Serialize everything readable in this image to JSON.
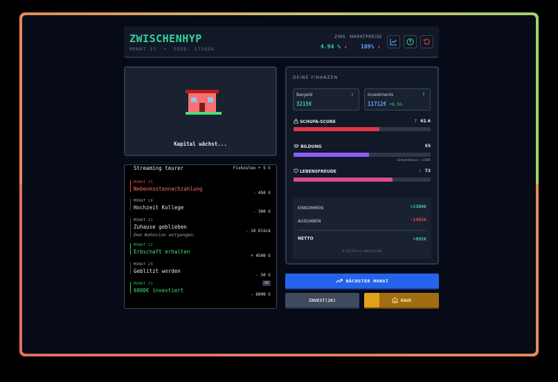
{
  "header": {
    "title": "ZWISCHENHYP",
    "month_label": "MONAT 23",
    "separator": "•",
    "seed_label": "SEED: 175688",
    "zins_label": "ZINS",
    "zins_value": "4.94 %",
    "zins_trend": "↓",
    "markt_label": "MARKTPREISE",
    "markt_value": "109%",
    "markt_trend": "↓",
    "buttons": [
      "chart-icon",
      "help-icon",
      "reset-icon"
    ]
  },
  "house": {
    "caption": "Kapital wächst..."
  },
  "log": [
    {
      "month": "",
      "title": "Streaming teurer",
      "amount": "Fixkosten + 5 €",
      "note": "",
      "tone": "gray"
    },
    {
      "month": "MONAT 15",
      "title": "Nebenkostennachzahlung",
      "amount": "- 450 €",
      "note": "",
      "tone": "red"
    },
    {
      "month": "MONAT 18",
      "title": "Hochzeit Kollege",
      "amount": "- 300 €",
      "note": "",
      "tone": "gray"
    },
    {
      "month": "MONAT 21",
      "title": "Zuhause geblieben",
      "amount": "- 10 Glück",
      "note": "Dem Wahnsinn entgangen.",
      "tone": "gray"
    },
    {
      "month": "MONAT 22",
      "title": "Erbschaft erhalten",
      "amount": "+ 4500 €",
      "note": "",
      "tone": "green"
    },
    {
      "month": "MONAT 23",
      "title": "Geblitzt worden",
      "amount": "- 50 €",
      "note": "",
      "tone": "gray"
    },
    {
      "month": "MONAT 23",
      "title": "6000€ investiert",
      "amount": "- 6000 €",
      "note": "",
      "tone": "green",
      "badge": "X6"
    }
  ],
  "finances": {
    "title": "DEINE FINANZEN",
    "cash": {
      "label": "Bargeld",
      "value": "3215€",
      "trend": "↓"
    },
    "investments": {
      "label": "Investments",
      "value": "11712€",
      "change": "+6.5%",
      "trend": "↑"
    },
    "schufa": {
      "label": "SCHUFA-SCORE",
      "value": "62.6",
      "trend": "↑",
      "level": 0.626,
      "color": "#dc3545"
    },
    "bildung": {
      "label": "BILDUNG",
      "value": "55",
      "level": 0.55,
      "color": "#8b5cf6",
      "bonus": "Gehalt-Bonus: +330€"
    },
    "lebensfreude": {
      "label": "LEBENSFREUDE",
      "value": "72",
      "trend": "↓",
      "level": 0.72,
      "color": "#db4d8a"
    },
    "einkommen": {
      "label": "EINKOMMEN",
      "value": "+2300€"
    },
    "ausgaben": {
      "label": "AUSGABEN",
      "value": "-1405€"
    },
    "netto": {
      "label": "NETTO",
      "value": "+895€"
    },
    "details": "⊕ DETAILS ANZEIGEN"
  },
  "actions": {
    "next_month": "NÄCHSTER MONAT",
    "invest": "INVEST(1K)",
    "haus": "HAUS",
    "haus_progress": 0.2
  },
  "colors": {
    "accent_green": "#34d399",
    "accent_red": "#ef4444",
    "accent_blue": "#60a5fa",
    "primary_button": "#2563eb",
    "gold": "#e0a31c"
  }
}
